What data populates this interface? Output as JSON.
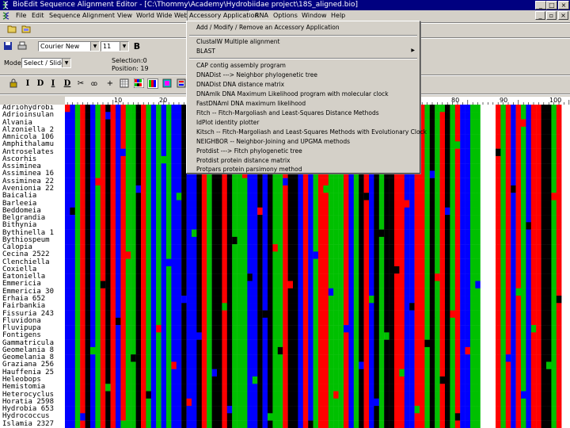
{
  "window": {
    "title": "BioEdit Sequence Alignment Editor - [C:\\Thommy\\Academy\\Hydrobiidae project\\18S_aligned.bio]",
    "min_label": "_",
    "max_label": "□",
    "close_label": "×"
  },
  "menu": {
    "items": [
      "File",
      "Edit",
      "Sequence",
      "Alignment",
      "View",
      "World Wide Web",
      "Accessory Application",
      "RNA",
      "Options",
      "Window",
      "Help"
    ]
  },
  "toolbar": {
    "font": "Courier New",
    "font_size": "11",
    "mode_label": "Mode:",
    "mode_value": "Select / Slide",
    "selection_label": "Selection:",
    "selection_value": "0",
    "position_label": "Position:",
    "position_value": "19"
  },
  "accessory_menu": {
    "items": [
      "Add / Modify / Remove an Accessory Application",
      "ClustalW Multiple alignment",
      "BLAST",
      "CAP contig assembly program",
      "DNADist ---> Neighbor phylogenetic tree",
      "DNADist DNA distance matrix",
      "DNAmlk DNA Maximum Likelihood program with molecular clock",
      "FastDNAml DNA maximum likelihood",
      "Fitch -- Fitch-Margoliash and Least-Squares Distance Methods",
      "IdPlot identity plotter",
      "Kitsch -- Fitch-Margoliash and Least-Squares Methods with Evolutionary Clock",
      "NEIGHBOR -- Neighbor-Joining and UPGMA methods",
      "Protdist ---> Fitch phylogenetic tree",
      "Protdist protein distance matrix",
      "Protpars protein parsimony method"
    ]
  },
  "ruler": {
    "ticks": [
      "10",
      "20",
      "80",
      "90",
      "100"
    ]
  },
  "sequences": {
    "names": [
      "Adriohydrobi",
      "Adrioinsulan",
      "Alvania",
      "Alzoniella 2",
      "Amnicola 106",
      "Amphithalamu",
      "Antroselates",
      "Ascorhis",
      "Assiminea",
      "Assiminea 16",
      "Assiminea 22",
      "Avenionia 22",
      "Baicalia",
      "Barleeia",
      "Beddomeia",
      "Belgrandia",
      "Bithynia",
      "Bythinella 1",
      "Bythiospeum",
      "Calopia",
      "Cecina 2522",
      "Clenchiella",
      "Coxiella",
      "Eatoniella",
      "Emmericia",
      "Emmericia 30",
      "Erhaia 652",
      "Fairbankia",
      "Fissuria 243",
      "Fluvidona",
      "Fluvipupa",
      "Fontigens",
      "Gammatricula",
      "Geomelania 8",
      "Geomelania 8",
      "Graziana 256",
      "Hauffenia 25",
      "Heleobops",
      "Hemistomia",
      "Heterocyclus",
      "Horatia 2598",
      "Hydrobia 653",
      "Hydrococcus",
      "Islamia 2327"
    ],
    "row_pattern": "CCAUGCAUGUCUAAGUACACACCGCCGUAGGUGAAACCGCGAAUGGCUCAUUAAAUCAGUCGAGGUUCCUUAGAUGAUCCAA---UAUCUACUUGGAU",
    "colors": {
      "A": "#00c000",
      "C": "#0000ff",
      "G": "#000000",
      "U": "#ff0000",
      "gap": "#ffffff"
    }
  }
}
